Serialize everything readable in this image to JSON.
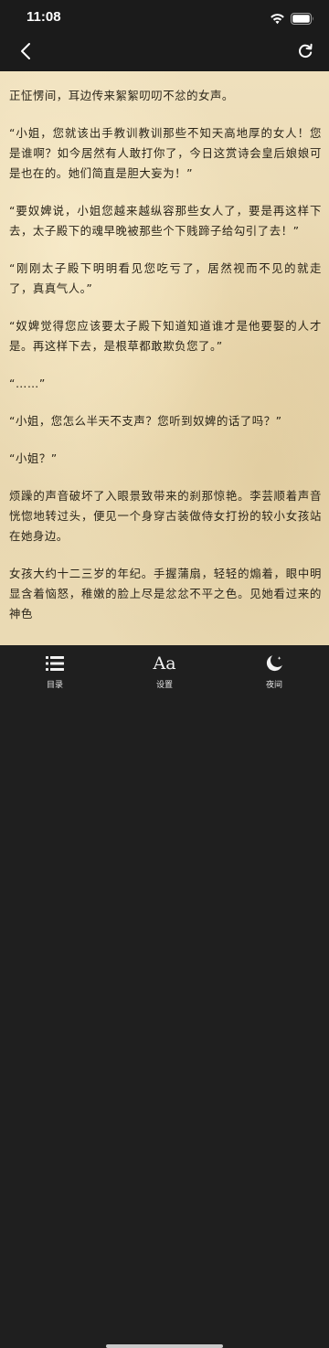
{
  "status_bar": {
    "time": "11:08",
    "icons": [
      "wifi-icon",
      "battery-icon"
    ]
  },
  "nav_bar": {
    "back_icon": "chevron-left-icon",
    "refresh_icon": "refresh-icon"
  },
  "reader": {
    "paragraphs": [
      "正怔愣间，耳边传来絮絮叨叨不忿的女声。",
      "“小姐，您就该出手教训教训那些不知天高地厚的女人！您是谁啊？如今居然有人敢打你了，今日这赏诗会皇后娘娘可是也在的。她们简直是胆大妄为！”",
      "“要奴婢说，小姐您越来越纵容那些女人了，要是再这样下去，太子殿下的魂早晚被那些个下贱蹄子给勾引了去！”",
      "“刚刚太子殿下明明看见您吃亏了，居然视而不见的就走了，真真气人。”",
      "“奴婢觉得您应该要太子殿下知道知道谁才是他要娶的人才是。再这样下去，是根草都敢欺负您了。”",
      "“……”",
      "“小姐，您怎么半天不支声？您听到奴婢的话了吗？”",
      "“小姐？”",
      "烦躁的声音破坏了入眼景致带来的刹那惊艳。李芸顺着声音恍惚地转过头，便见一个身穿古装做侍女打扮的较小女孩站在她身边。",
      "女孩大约十二三岁的年纪。手握蒲扇，轻轻的煽着，眼中明显含着恼怒，稚嫩的脸上尽是忿忿不平之色。见她看过来的神色"
    ]
  },
  "tab_bar": {
    "items": [
      {
        "label": "目录",
        "icon": "list-icon"
      },
      {
        "label": "设置",
        "icon": "Aa"
      },
      {
        "label": "夜间",
        "icon": "moon-icon"
      }
    ]
  },
  "colors": {
    "chrome_background": "#1b1b1b",
    "paper": "#ecdcb7",
    "text": "#2a2418",
    "tab_label": "#e6e6e6"
  }
}
